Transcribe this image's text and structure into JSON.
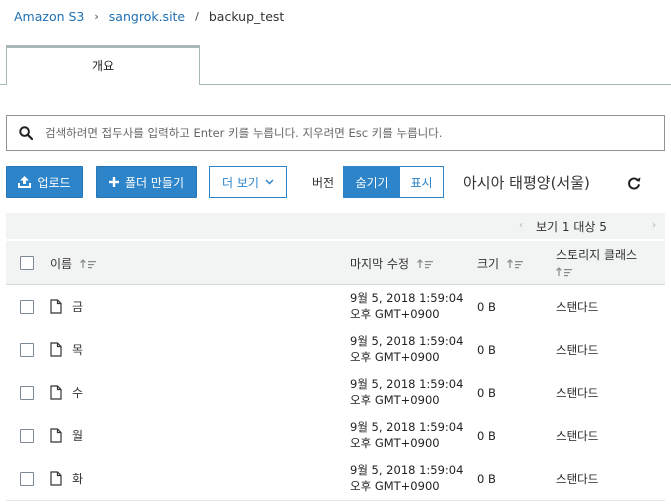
{
  "breadcrumb": {
    "items": [
      "Amazon S3",
      "sangrok.site",
      "backup_test"
    ],
    "separator_1": "›",
    "separator_2": "/"
  },
  "tabs": [
    {
      "label": "개요"
    }
  ],
  "search": {
    "placeholder": "검색하려면 접두사를 입력하고 Enter 키를 누릅니다. 지우려면 Esc 키를 누릅니다.",
    "value": ""
  },
  "toolbar": {
    "upload_label": "업로드",
    "create_folder_label": "폴더 만들기",
    "more_label": "더 보기",
    "version_label": "버전",
    "version_hide": "숨기기",
    "version_show": "표시",
    "region": "아시아 태평양(서울)"
  },
  "pagination": {
    "prev": "‹",
    "text": "보기 1 대상 5",
    "next": "›"
  },
  "table": {
    "columns": [
      "이름",
      "마지막 수정",
      "크기",
      "스토리지 클래스"
    ],
    "rows": [
      {
        "name": "금",
        "modified_date": "9월 5, 2018 1:59:04",
        "modified_time": "오후 GMT+0900",
        "size": "0 B",
        "storage": "스탠다드"
      },
      {
        "name": "목",
        "modified_date": "9월 5, 2018 1:59:04",
        "modified_time": "오후 GMT+0900",
        "size": "0 B",
        "storage": "스탠다드"
      },
      {
        "name": "수",
        "modified_date": "9월 5, 2018 1:59:04",
        "modified_time": "오후 GMT+0900",
        "size": "0 B",
        "storage": "스탠다드"
      },
      {
        "name": "월",
        "modified_date": "9월 5, 2018 1:59:04",
        "modified_time": "오후 GMT+0900",
        "size": "0 B",
        "storage": "스탠다드"
      },
      {
        "name": "화",
        "modified_date": "9월 5, 2018 1:59:04",
        "modified_time": "오후 GMT+0900",
        "size": "0 B",
        "storage": "스탠다드"
      }
    ]
  },
  "icons": {
    "search": "search-icon",
    "upload": "upload-icon",
    "plus": "plus-icon",
    "chevron": "chevron-down-icon",
    "refresh": "refresh-icon",
    "file": "file-icon",
    "sort": "sort-icon"
  },
  "colors": {
    "accent": "#2d84c9",
    "link": "#1f6fb2",
    "header_bg": "#f2f3f3"
  }
}
